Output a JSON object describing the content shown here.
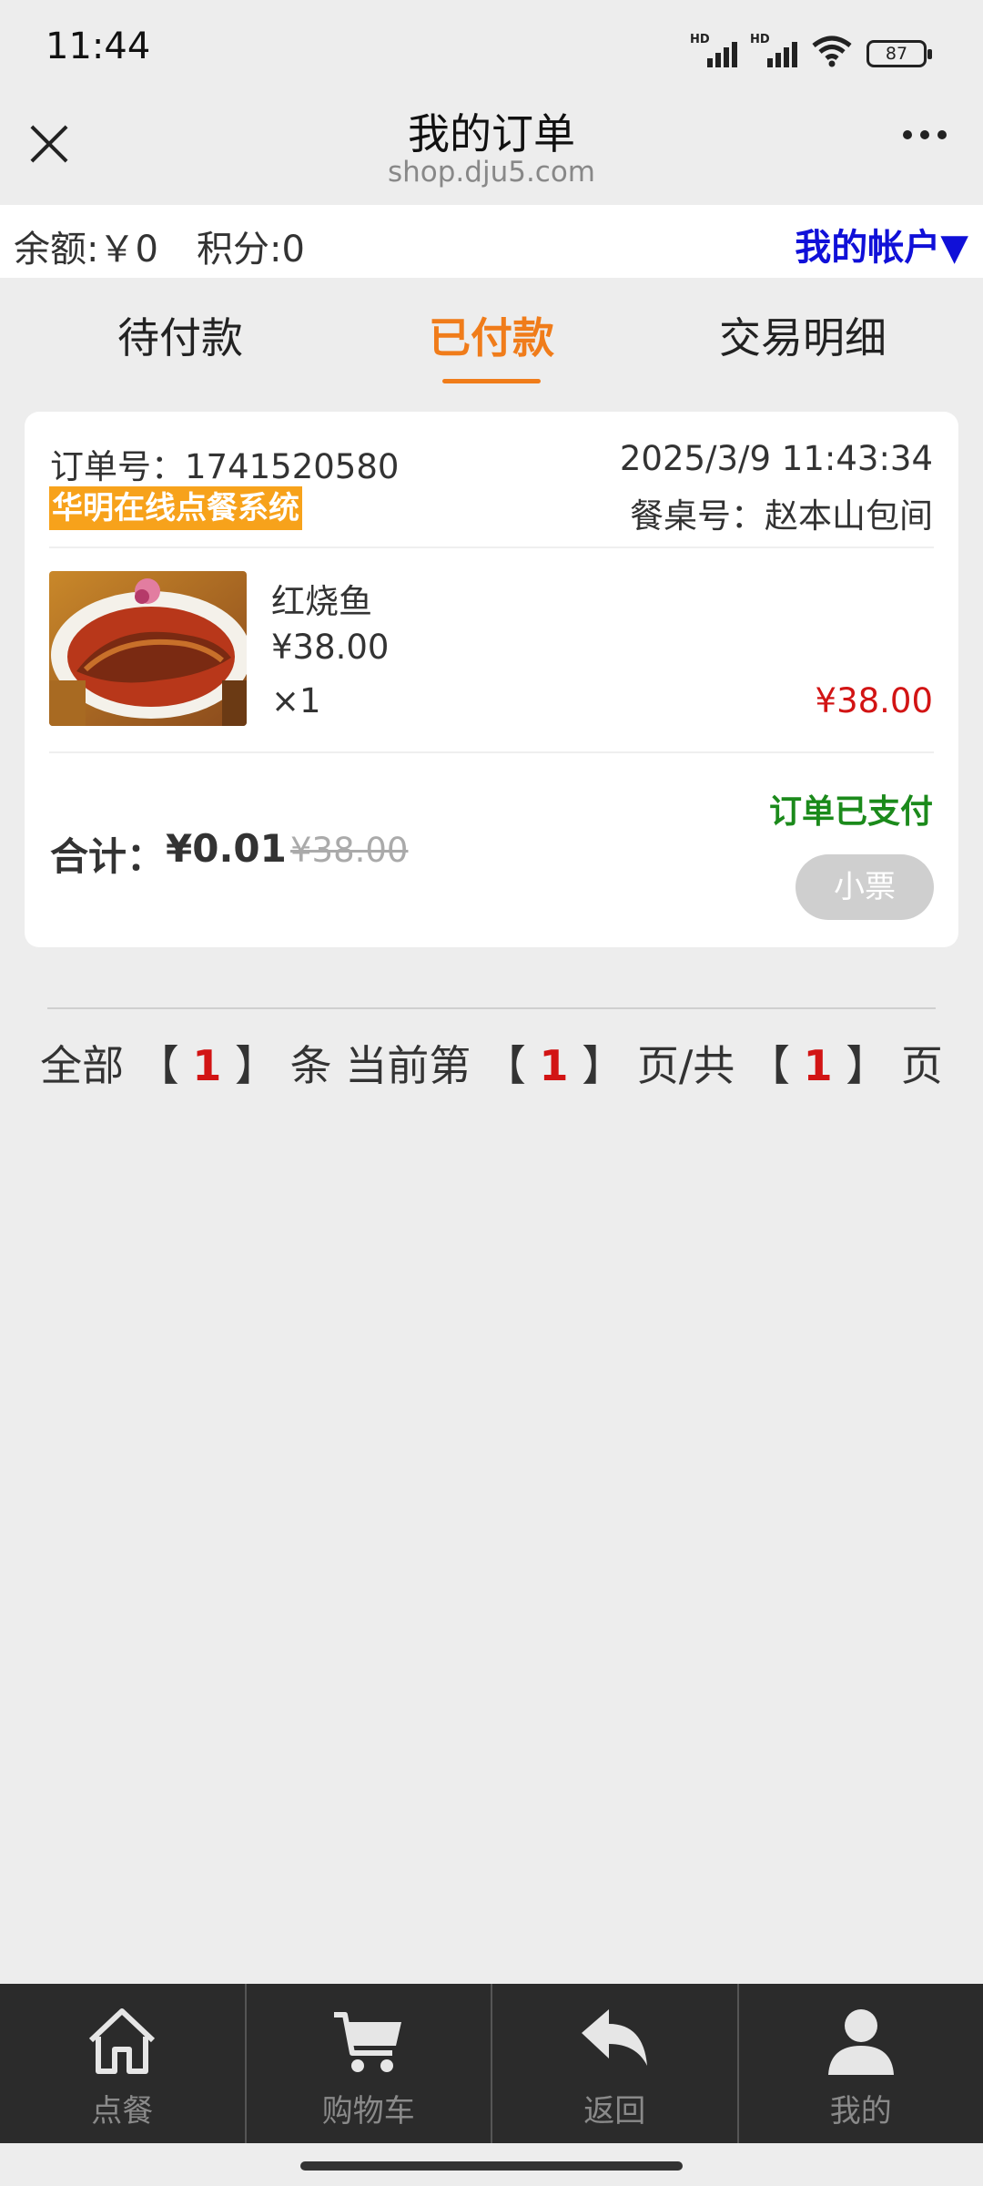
{
  "status_bar": {
    "time": "11:44",
    "signal1_label": "HD",
    "signal2_label": "HD",
    "battery": "87"
  },
  "header": {
    "title": "我的订单",
    "subtitle": "shop.dju5.com"
  },
  "account": {
    "balance": "余额:￥0",
    "points": "积分:0",
    "my_account": "我的帐户▼"
  },
  "tabs": [
    {
      "label": "待付款",
      "active": false
    },
    {
      "label": "已付款",
      "active": true
    },
    {
      "label": "交易明细",
      "active": false
    }
  ],
  "order": {
    "order_no": "订单号：1741520580",
    "time": "2025/3/9 11:43:34",
    "shop": "华明在线点餐系统",
    "table": "餐桌号：赵本山包间",
    "item": {
      "name": "红烧鱼",
      "price": "¥38.00",
      "qty": "×1",
      "subtotal": "¥38.00"
    },
    "status": "订单已支付",
    "total_label": "合计：",
    "total": "¥0.01",
    "original_total": "¥38.00",
    "receipt_button": "小票"
  },
  "pagination": {
    "all": "全部",
    "open": "【",
    "close": "】",
    "items_unit": "条",
    "current": "当前第",
    "pages_unit": "页/共",
    "pages_end": "页",
    "total_items": "1",
    "current_page": "1",
    "total_pages": "1"
  },
  "bottom_nav": [
    {
      "label": "点餐",
      "icon": "home-icon"
    },
    {
      "label": "购物车",
      "icon": "cart-icon"
    },
    {
      "label": "返回",
      "icon": "back-icon"
    },
    {
      "label": "我的",
      "icon": "user-icon"
    }
  ],
  "colors": {
    "accent": "#f07c1a",
    "price_red": "#d21414",
    "paid_green": "#1b8a1b",
    "link_blue": "#1010d8",
    "tag_orange": "#f7a21b"
  }
}
